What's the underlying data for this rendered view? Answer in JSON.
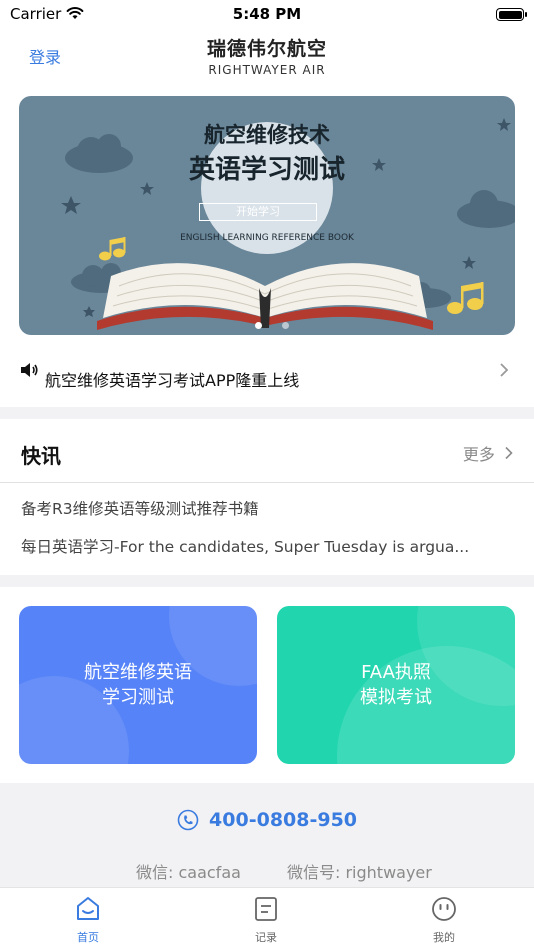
{
  "status_bar": {
    "carrier": "Carrier",
    "time": "5:48 PM"
  },
  "nav": {
    "login_label": "登录",
    "brand_name": "瑞德伟尔航空",
    "brand_sub": "RIGHTWAYER AIR"
  },
  "banner": {
    "title_line1": "航空维修技术",
    "title_line2": "英语学习测试",
    "start_label": "开始学习",
    "subtitle": "ENGLISH LEARNING REFERENCE BOOK",
    "slide_count": 2,
    "active_slide": 1
  },
  "notice": {
    "text": "航空维修英语学习考试APP隆重上线"
  },
  "news": {
    "title": "快讯",
    "more_label": "更多",
    "items": [
      "备考R3维修英语等级测试推荐书籍",
      "每日英语学习-For the candidates, Super Tuesday is argua..."
    ]
  },
  "cards": {
    "english": {
      "line1": "航空维修英语",
      "line2": "学习测试"
    },
    "faa": {
      "line1": "FAA执照",
      "line2": "模拟考试"
    }
  },
  "contact": {
    "phone": "400-0808-950",
    "wechat": "微信: caacfaa",
    "wechat_id": "微信号: rightwayer"
  },
  "tabs": [
    {
      "label": "首页",
      "icon": "home-smile-icon",
      "active": true
    },
    {
      "label": "记录",
      "icon": "record-icon",
      "active": false
    },
    {
      "label": "我的",
      "icon": "profile-face-icon",
      "active": false
    }
  ],
  "colors": {
    "accent": "#3a7be0",
    "banner_bg": "#6a8699",
    "card_english": "#5683f7",
    "card_faa": "#21d5af"
  }
}
